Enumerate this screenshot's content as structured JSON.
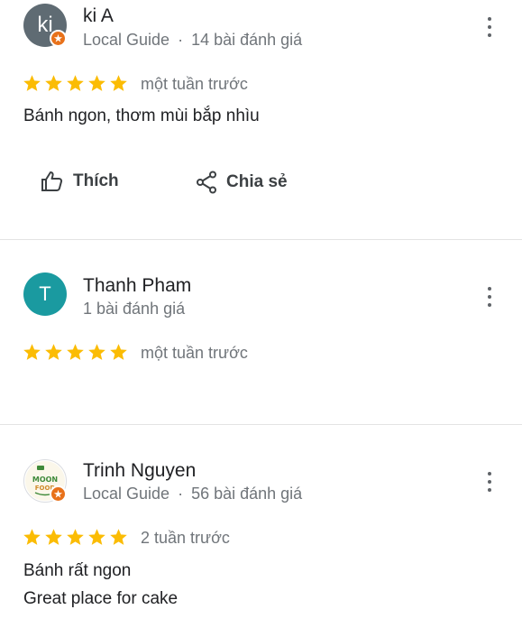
{
  "reviews": [
    {
      "avatar_text": "ki",
      "avatar_color": "#5f6b73",
      "has_badge": true,
      "name": "ki A",
      "guide_label": "Local Guide",
      "separator": "·",
      "count_label": "14 bài đánh giá",
      "rating": 5,
      "time": "một tuần trước",
      "text_lines": [
        "Bánh ngon, thơm mùi bắp nhìu"
      ],
      "actions": {
        "like": "Thích",
        "share": "Chia sẻ"
      }
    },
    {
      "avatar_text": "T",
      "avatar_color": "#1a9aa0",
      "has_badge": false,
      "name": "Thanh Pham",
      "count_label": "1 bài đánh giá",
      "rating": 5,
      "time": "một tuần trước"
    },
    {
      "avatar_logo": [
        "MOON",
        "FOOD"
      ],
      "has_badge": true,
      "name": "Trinh Nguyen",
      "guide_label": "Local Guide",
      "separator": "·",
      "count_label": "56 bài đánh giá",
      "rating": 5,
      "time": "2 tuần trước",
      "text_lines": [
        "Bánh rất ngon",
        "Great place for cake"
      ]
    }
  ],
  "colors": {
    "star": "#fbbc04",
    "badge": "#e8711a",
    "meta_text": "#70757a"
  },
  "icons": [
    "more-vert-icon",
    "star-icon",
    "thumb-up-icon",
    "share-icon",
    "local-guide-badge-icon"
  ]
}
